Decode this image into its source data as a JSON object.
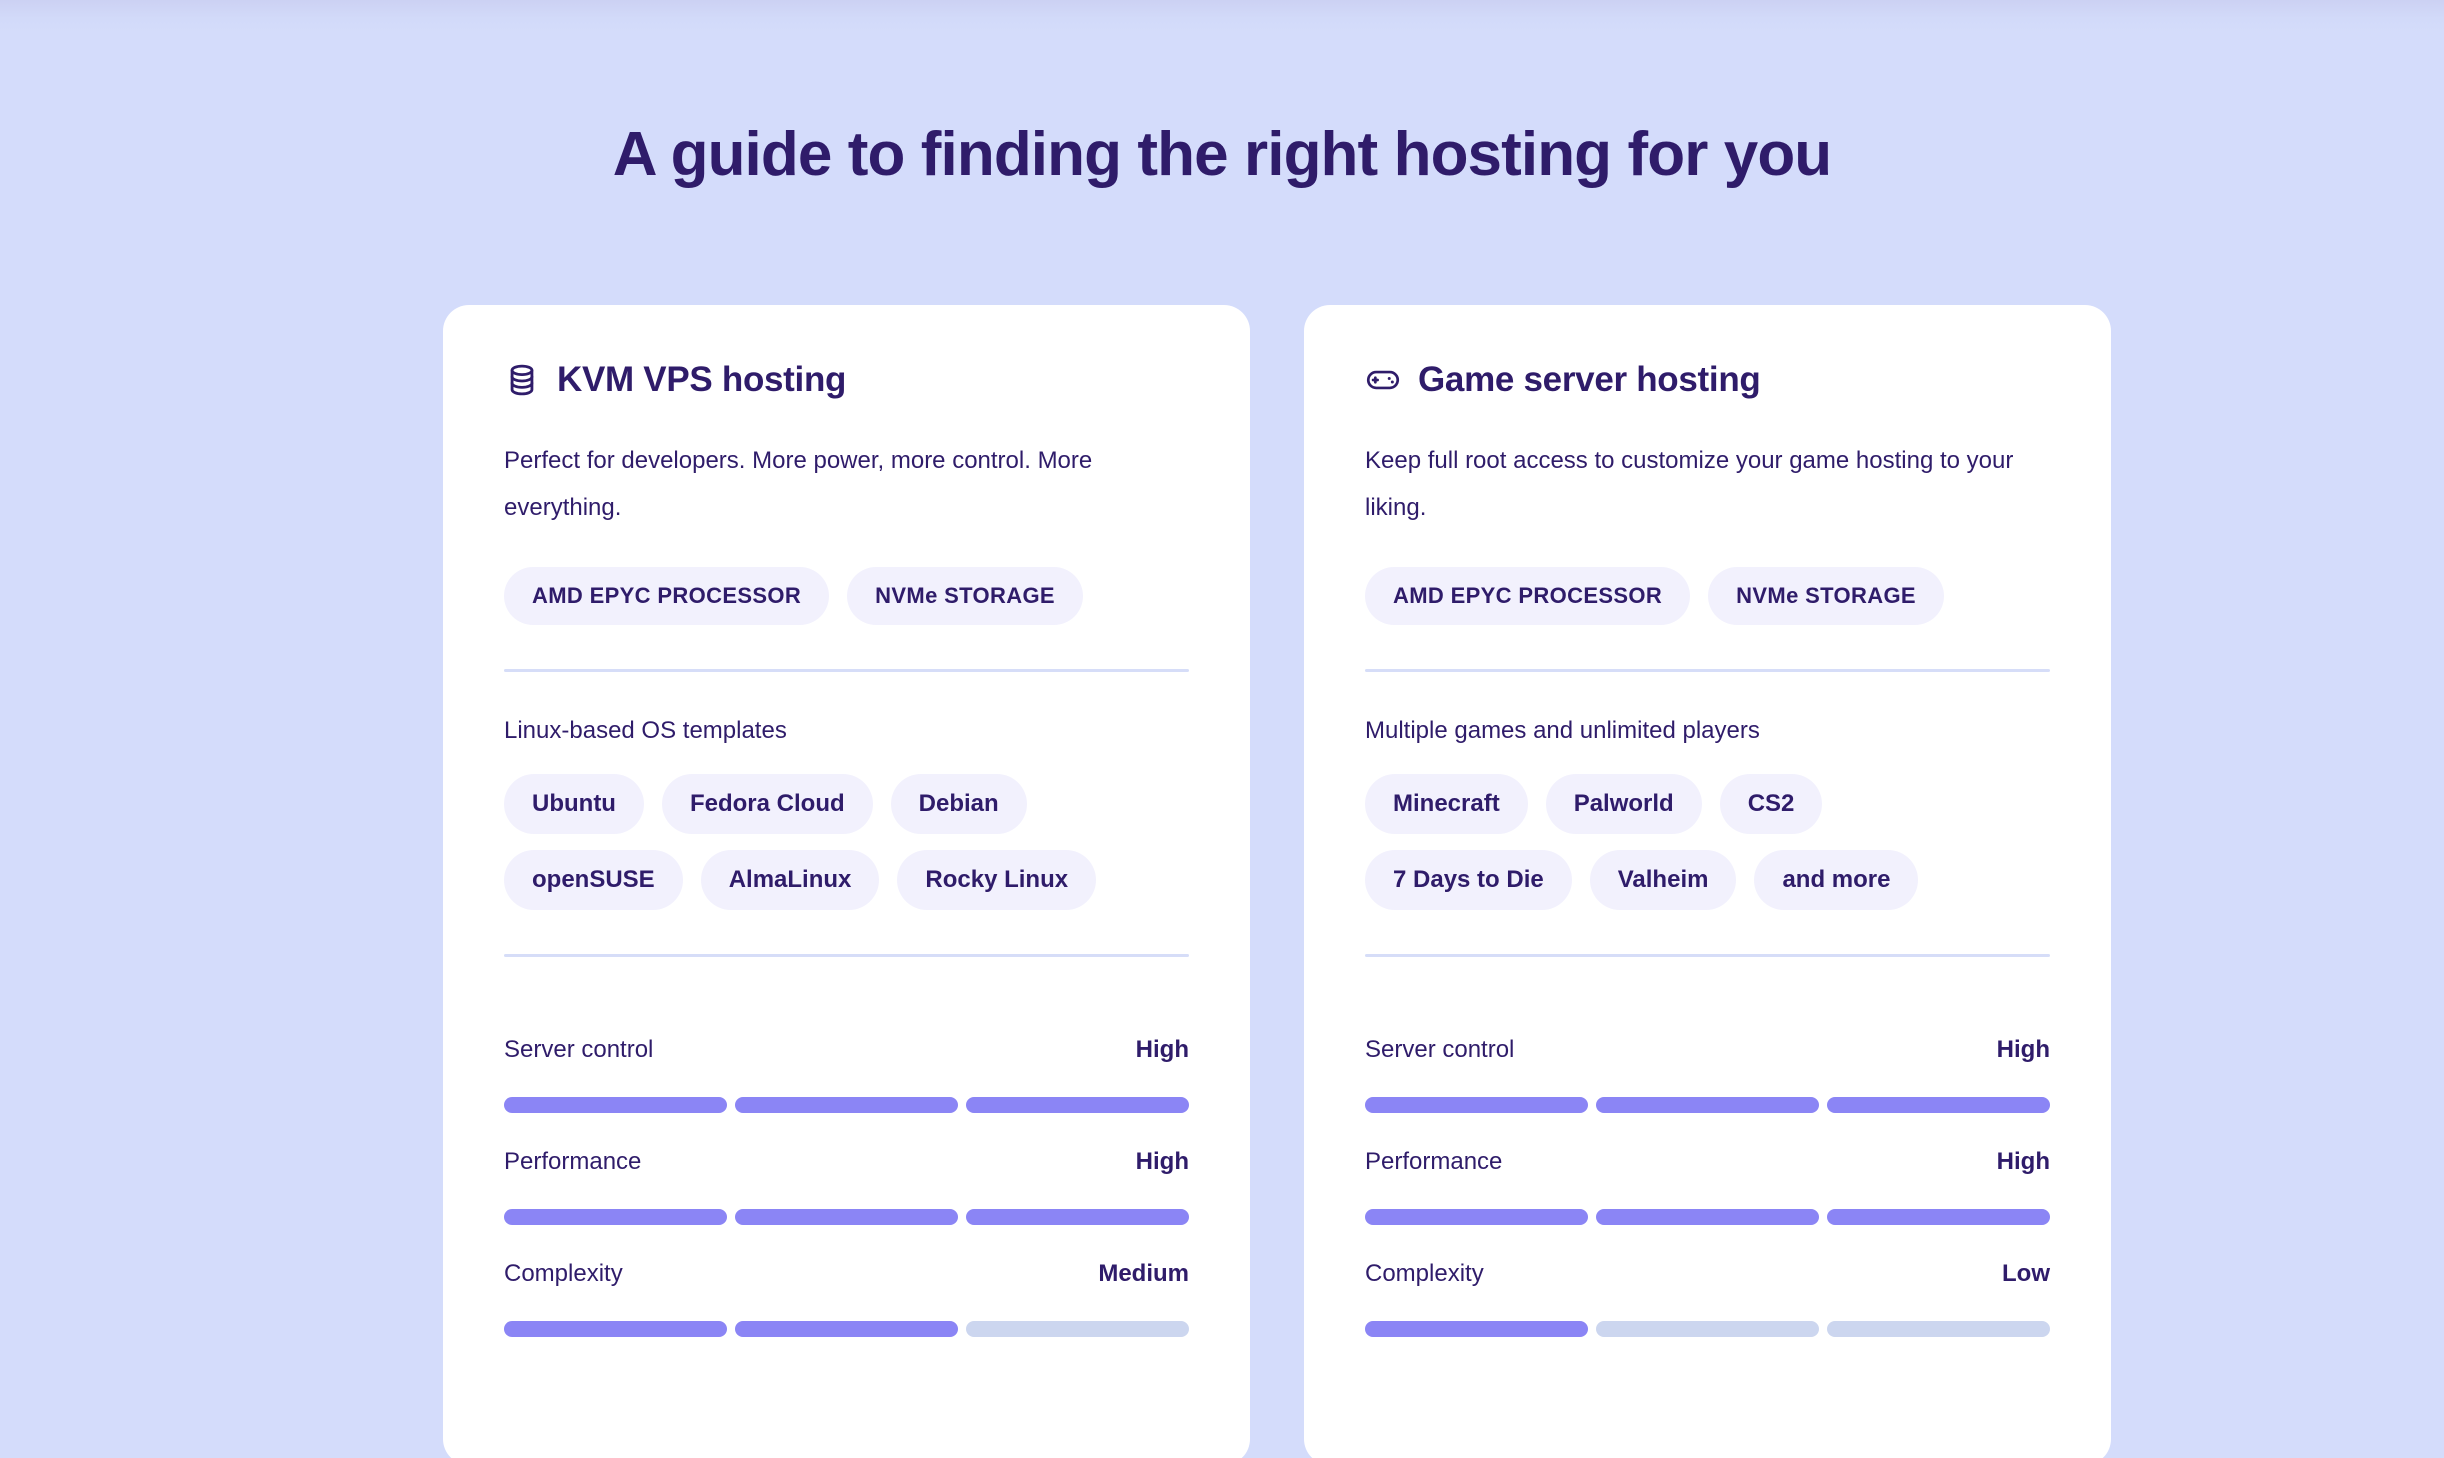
{
  "page": {
    "title": "A guide to finding the right hosting for you",
    "background_color": "#d4dcfb",
    "accent_color": "#8b85f5",
    "text_color": "#2f1c6a",
    "pill_background": "#f2f1fd",
    "bar_empty_color": "#ccd6ef"
  },
  "cards": [
    {
      "icon": "database-icon",
      "title": "KVM VPS hosting",
      "description": "Perfect for developers. More power, more control. More everything.",
      "specs": [
        "AMD EPYC PROCESSOR",
        "NVMe STORAGE"
      ],
      "section_label": "Linux-based OS templates",
      "tag_rows": [
        [
          "Ubuntu",
          "Fedora Cloud",
          "Debian"
        ],
        [
          "openSUSE",
          "AlmaLinux",
          "Rocky Linux"
        ]
      ],
      "metrics": [
        {
          "name": "Server control",
          "value": "High",
          "filled": 3,
          "total": 3
        },
        {
          "name": "Performance",
          "value": "High",
          "filled": 3,
          "total": 3
        },
        {
          "name": "Complexity",
          "value": "Medium",
          "filled": 2,
          "total": 3
        }
      ]
    },
    {
      "icon": "gamepad-icon",
      "title": "Game server hosting",
      "description": "Keep full root access to customize your game hosting to your liking.",
      "specs": [
        "AMD EPYC PROCESSOR",
        "NVMe STORAGE"
      ],
      "section_label": "Multiple games and unlimited players",
      "tag_rows": [
        [
          "Minecraft",
          "Palworld",
          "CS2"
        ],
        [
          "7 Days to Die",
          "Valheim",
          "and more"
        ]
      ],
      "metrics": [
        {
          "name": "Server control",
          "value": "High",
          "filled": 3,
          "total": 3
        },
        {
          "name": "Performance",
          "value": "High",
          "filled": 3,
          "total": 3
        },
        {
          "name": "Complexity",
          "value": "Low",
          "filled": 1,
          "total": 3
        }
      ]
    }
  ]
}
